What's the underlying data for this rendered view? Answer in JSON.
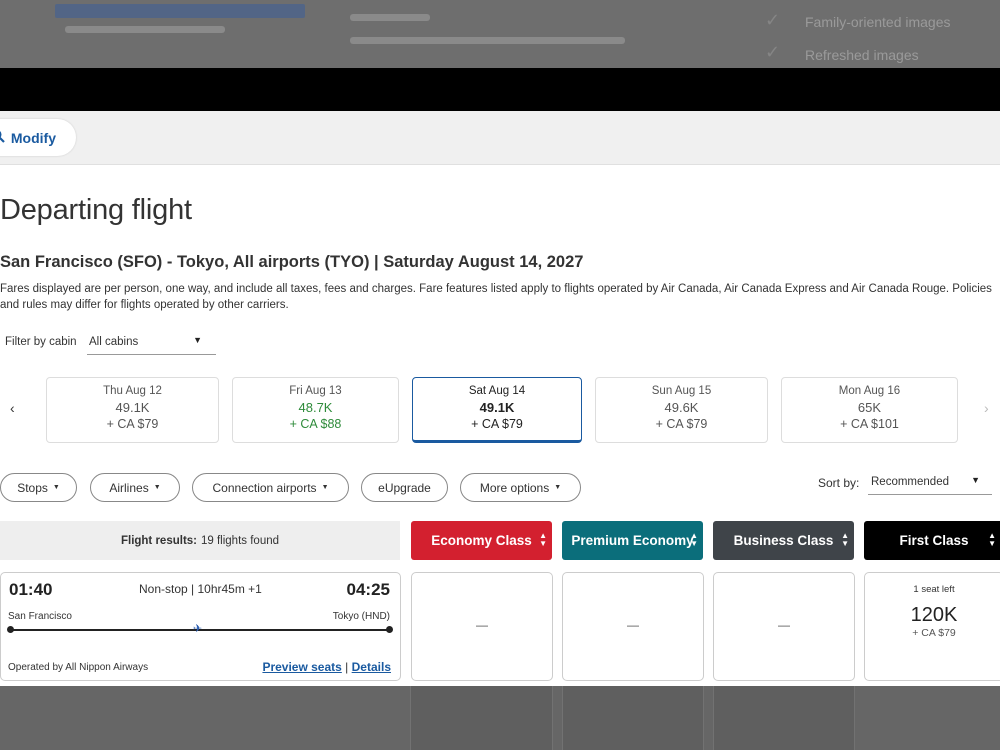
{
  "modify": {
    "label": "Modify"
  },
  "page_title": "Departing flight",
  "route": "San Francisco (SFO) - Tokyo, All airports (TYO)  |  Saturday August 14, 2027",
  "disclaimer": "Fares displayed are per person, one way, and include all taxes, fees and charges. Fare features listed apply to flights operated by Air Canada, Air Canada Express and Air Canada Rouge. Policies and rules may differ for flights operated by other carriers.",
  "filter": {
    "label": "Filter by cabin",
    "value": "All cabins"
  },
  "dates": [
    {
      "date": "Thu Aug 12",
      "points": "49.1K",
      "fee": "+ CA $79"
    },
    {
      "date": "Fri Aug 13",
      "points": "48.7K",
      "fee": "+ CA $88"
    },
    {
      "date": "Sat Aug 14",
      "points": "49.1K",
      "fee": "+ CA $79"
    },
    {
      "date": "Sun Aug 15",
      "points": "49.6K",
      "fee": "+ CA $79"
    },
    {
      "date": "Mon Aug 16",
      "points": "65K",
      "fee": "+ CA $101"
    }
  ],
  "filters": {
    "stops": "Stops",
    "airlines": "Airlines",
    "connection": "Connection airports",
    "eupgrade": "eUpgrade",
    "more": "More options"
  },
  "sort": {
    "label": "Sort by:",
    "value": "Recommended"
  },
  "results": {
    "label": "Flight results:",
    "count": "19 flights found"
  },
  "cabins": [
    {
      "name": "Economy Class",
      "color": "#d3202f"
    },
    {
      "name": "Premium Economy",
      "color": "#0b6e7b"
    },
    {
      "name": "Business Class",
      "color": "#3f4449"
    },
    {
      "name": "First Class",
      "color": "#000000"
    }
  ],
  "flight": {
    "depart_time": "01:40",
    "arrive_time": "04:25",
    "summary": "Non-stop | 10hr45m +1",
    "from": "San Francisco",
    "to": "Tokyo (HND)",
    "operated_by": "Operated by All Nippon Airways",
    "preview_seats": "Preview seats",
    "details": "Details",
    "link_sep": "|"
  },
  "fares": {
    "economy": "—",
    "premium": "—",
    "business": "—",
    "first": {
      "seats": "1 seat left",
      "points": "120K",
      "fee": "+ CA $79"
    }
  },
  "background": {
    "right_text_1": "Family-oriented images",
    "right_text_2": "Refreshed images"
  }
}
